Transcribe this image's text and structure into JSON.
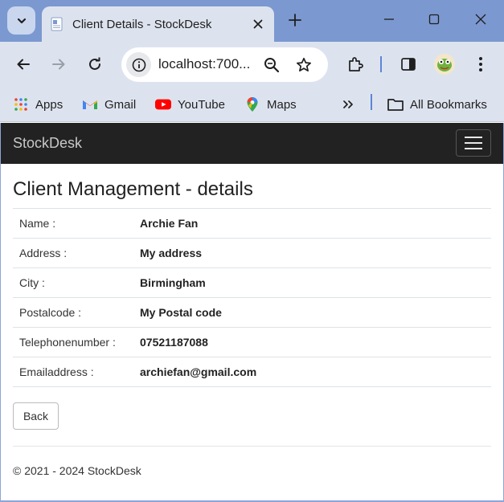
{
  "browser": {
    "tab": {
      "title": "Client Details - StockDesk"
    },
    "address_bar": {
      "url": "localhost:700..."
    },
    "bookmarks": [
      {
        "label": "Apps",
        "icon": "apps-grid-icon"
      },
      {
        "label": "Gmail",
        "icon": "gmail-icon"
      },
      {
        "label": "YouTube",
        "icon": "youtube-icon"
      },
      {
        "label": "Maps",
        "icon": "maps-icon"
      }
    ],
    "all_bookmarks_label": "All Bookmarks",
    "colors": {
      "frame": "#7b98d0",
      "toolbar": "#dde3ee"
    }
  },
  "app": {
    "brand": "StockDesk",
    "navbar_color": "#222222"
  },
  "page": {
    "title": "Client Management - details",
    "fields": [
      {
        "label": "Name :",
        "value": "Archie Fan"
      },
      {
        "label": "Address :",
        "value": "My address"
      },
      {
        "label": "City :",
        "value": "Birmingham"
      },
      {
        "label": "Postalcode :",
        "value": "My Postal code"
      },
      {
        "label": "Telephonenumber :",
        "value": "07521187088"
      },
      {
        "label": "Emailaddress :",
        "value": "archiefan@gmail.com"
      }
    ],
    "back_label": "Back",
    "footer": "© 2021 - 2024 StockDesk"
  }
}
